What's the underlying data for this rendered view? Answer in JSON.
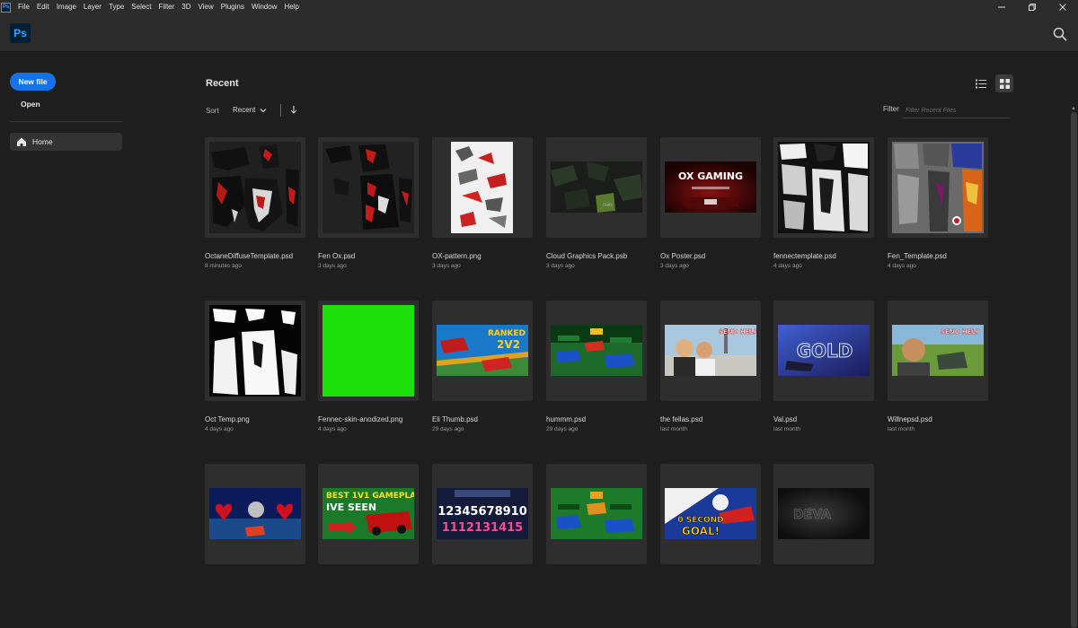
{
  "menubar": {
    "app_icon": "Ps",
    "items": [
      "File",
      "Edit",
      "Image",
      "Layer",
      "Type",
      "Select",
      "Filter",
      "3D",
      "View",
      "Plugins",
      "Window",
      "Help"
    ],
    "controls": [
      "minimize-icon",
      "restore-icon",
      "close-icon"
    ]
  },
  "header": {
    "logo": "Ps",
    "search_icon": "search-icon"
  },
  "sidebar": {
    "new_file": "New file",
    "open": "Open",
    "home": "Home"
  },
  "main": {
    "title": "Recent",
    "sort_label": "Sort",
    "sort_value": "Recent",
    "filter_label": "Filter",
    "filter_placeholder": "Filter Recent Files"
  },
  "files": [
    {
      "name": "OctaneDiffuseTemplate.psd",
      "date": "8 minutes ago",
      "thumb": "red-black-uv-template"
    },
    {
      "name": "Fen Ox.psd",
      "date": "3 days ago",
      "thumb": "red-black-uv-template"
    },
    {
      "name": "OX-pattern.png",
      "date": "3 days ago",
      "thumb": "white-red-pattern"
    },
    {
      "name": "Cloud Graphics Pack.psb",
      "date": "3 days ago",
      "thumb": "dark-camo"
    },
    {
      "name": "Ox Poster.psd",
      "date": "3 days ago",
      "thumb": "ox-gaming-poster"
    },
    {
      "name": "fennectemplate.psd",
      "date": "4 days ago",
      "thumb": "bw-uv-template"
    },
    {
      "name": "Fen_Template.psd",
      "date": "4 days ago",
      "thumb": "colored-uv-template"
    },
    {
      "name": "Oct Temp.png",
      "date": "4 days ago",
      "thumb": "white-on-black-template"
    },
    {
      "name": "Fennec-skin-anodized.png",
      "date": "4 days ago",
      "thumb": "green-square"
    },
    {
      "name": "Eli Thumb.psd",
      "date": "29 days ago",
      "thumb": "ranked-2v2-thumbnail"
    },
    {
      "name": "hummm.psd",
      "date": "29 days ago",
      "thumb": "cars-green-field"
    },
    {
      "name": "the fellas.psd",
      "date": "last month",
      "thumb": "send-help-thumbnail"
    },
    {
      "name": "Val.psd",
      "date": "last month",
      "thumb": "gold-text-thumbnail"
    },
    {
      "name": "Willnepsd.psd",
      "date": "last month",
      "thumb": "send-help-outdoor"
    },
    {
      "name": "",
      "date": "",
      "thumb": "hearts-arena"
    },
    {
      "name": "",
      "date": "",
      "thumb": "best-1v1-gameplay"
    },
    {
      "name": "",
      "date": "",
      "thumb": "numbers-countdown"
    },
    {
      "name": "",
      "date": "",
      "thumb": "cars-green-field"
    },
    {
      "name": "",
      "date": "",
      "thumb": "second-goal"
    },
    {
      "name": "",
      "date": "",
      "thumb": "dark-logo"
    }
  ],
  "colors": {
    "accent": "#1473e6",
    "ps_blue": "#31a8ff",
    "background": "#1e1e1e"
  }
}
